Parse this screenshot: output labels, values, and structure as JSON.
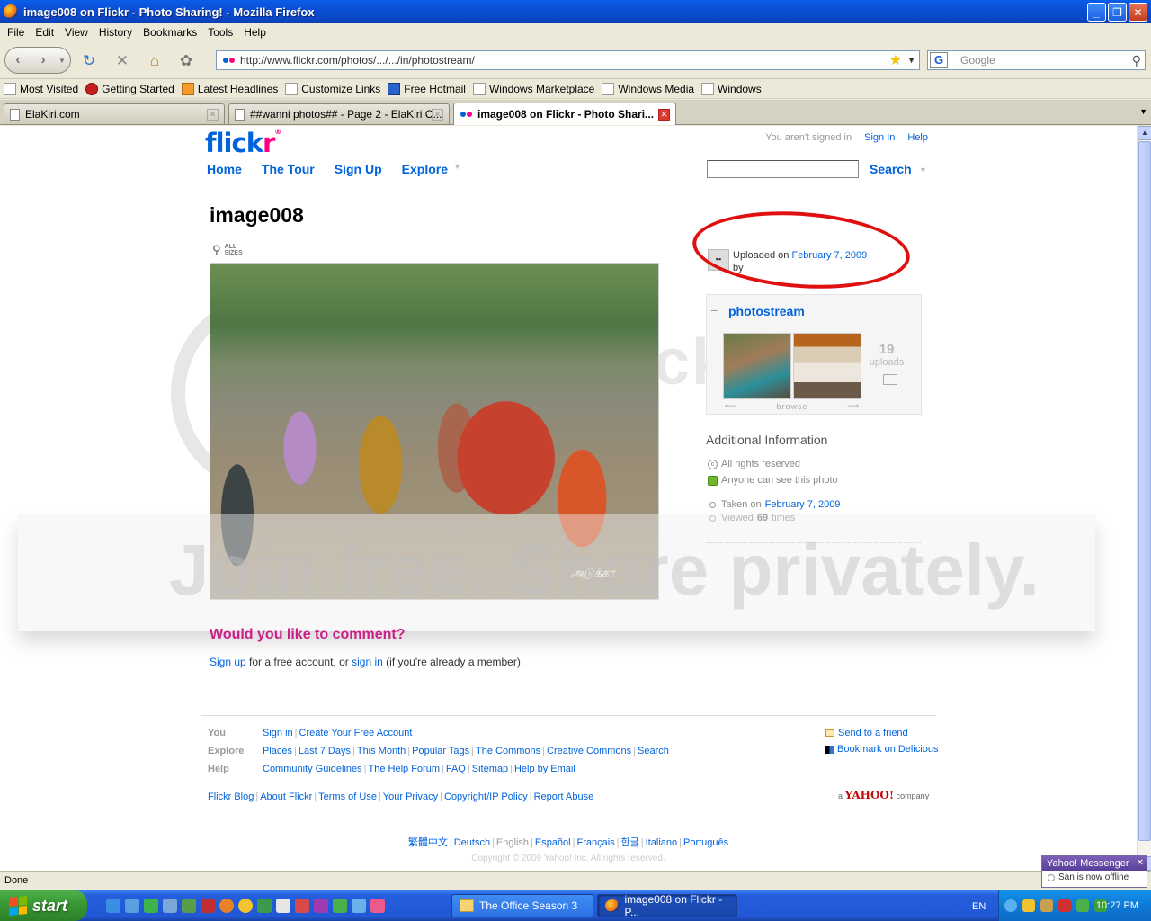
{
  "window": {
    "title": "image008 on Flickr - Photo Sharing! - Mozilla Firefox"
  },
  "menu": [
    "File",
    "Edit",
    "View",
    "History",
    "Bookmarks",
    "Tools",
    "Help"
  ],
  "nav": {
    "url": "http://www.flickr.com/photos/.../.../in/photostream/",
    "search_placeholder": "Google"
  },
  "bookmarks": [
    {
      "label": "Most Visited",
      "icon": "page-icon"
    },
    {
      "label": "Getting Started",
      "icon": "firefox-icon"
    },
    {
      "label": "Latest Headlines",
      "icon": "rss-icon"
    },
    {
      "label": "Customize Links",
      "icon": "page-icon"
    },
    {
      "label": "Free Hotmail",
      "icon": "msn-icon"
    },
    {
      "label": "Windows Marketplace",
      "icon": "page-icon"
    },
    {
      "label": "Windows Media",
      "icon": "page-icon"
    },
    {
      "label": "Windows",
      "icon": "page-icon"
    }
  ],
  "tabs": [
    {
      "label": "ElaKiri.com"
    },
    {
      "label": "##wanni photos## - Page 2 - ElaKiri C..."
    },
    {
      "label": "image008 on Flickr - Photo Shari..."
    }
  ],
  "flickr": {
    "logo_a": "flick",
    "logo_b": "r",
    "signed_text": "You aren't signed in",
    "sign_in": "Sign In",
    "help": "Help",
    "nav": [
      "Home",
      "The Tour",
      "Sign Up",
      "Explore"
    ],
    "search_btn": "Search"
  },
  "photo": {
    "title": "image008",
    "all_sizes_a": "ALL",
    "all_sizes_b": "SIZES",
    "signature": "அடுக்கா"
  },
  "sidebar": {
    "uploaded_prefix": "Uploaded on",
    "uploaded_date": "February 7, 2009",
    "by": "by",
    "photostream": "photostream",
    "uploads_count": "19",
    "uploads_label": "uploads",
    "browse": "browse",
    "additional_title": "Additional Information",
    "rights": "All rights reserved",
    "visibility": "Anyone can see this photo",
    "taken_prefix": "Taken on",
    "taken_date": "February 7, 2009",
    "viewed_prefix": "Viewed",
    "viewed_count": "69",
    "viewed_suffix": "times"
  },
  "comment": {
    "title": "Would you like to comment?",
    "sign_up": "Sign up",
    "middle": "for a free account, or",
    "sign_in": "sign in",
    "end": "(if you're already a member)."
  },
  "footer": {
    "you_label": "You",
    "you_links": [
      "Sign in",
      "Create Your Free Account"
    ],
    "explore_label": "Explore",
    "explore_links": [
      "Places",
      "Last 7 Days",
      "This Month",
      "Popular Tags",
      "The Commons",
      "Creative Commons",
      "Search"
    ],
    "help_label": "Help",
    "help_links": [
      "Community Guidelines",
      "The Help Forum",
      "FAQ",
      "Sitemap",
      "Help by Email"
    ],
    "send_friend": "Send to a friend",
    "bookmark_delicious": "Bookmark on Delicious",
    "bottom_links": [
      "Flickr Blog",
      "About Flickr",
      "Terms of Use",
      "Your Privacy",
      "Copyright/IP Policy",
      "Report Abuse"
    ],
    "yahoo_a": "a",
    "yahoo_brand": "YAHOO!",
    "yahoo_b": "company",
    "languages": [
      "繁體中文",
      "Deutsch",
      "English",
      "Español",
      "Français",
      "한글",
      "Italiano",
      "Português"
    ],
    "current_language": "English",
    "copyright": "Copyright © 2009 Yahoo! Inc. All rights reserved."
  },
  "watermark": {
    "brand": "photobucket",
    "join": "Join free. Share privately."
  },
  "status": {
    "text": "Done"
  },
  "messenger": {
    "title": "Yahoo! Messenger",
    "status": "San is now offline"
  },
  "taskbar": {
    "start": "start",
    "tasks": [
      {
        "label": "The Office Season 3"
      },
      {
        "label": "image008 on Flickr - P..."
      }
    ],
    "lang": "EN",
    "clock": "10:27 PM"
  }
}
